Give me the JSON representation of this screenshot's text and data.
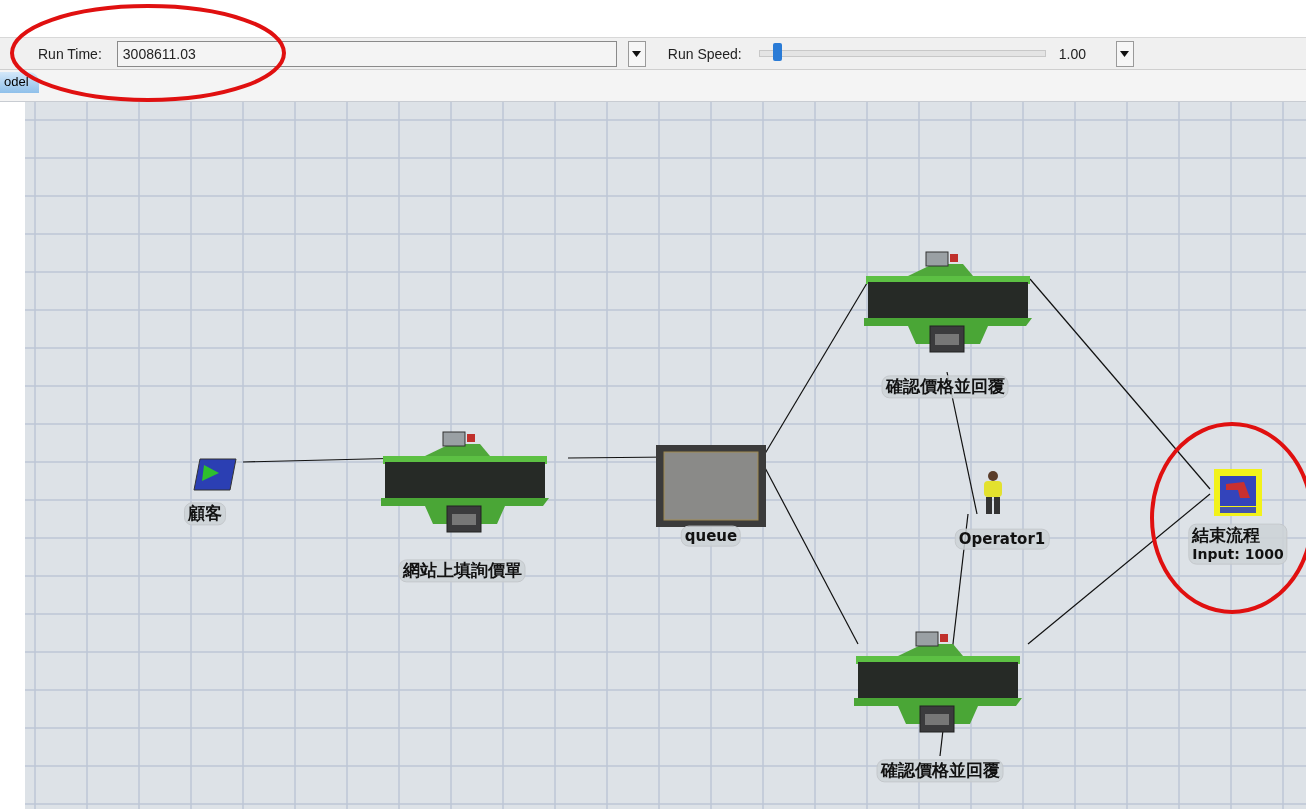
{
  "toolbar": {
    "run_time": {
      "label": "Run Time:",
      "value": "3008611.03"
    },
    "run_speed": {
      "label": "Run Speed:",
      "level": 0.06,
      "reading": "1.00"
    }
  },
  "tabs": [
    {
      "label": "odel",
      "selected": true
    }
  ],
  "model": {
    "nodes": [
      {
        "kind": "source",
        "label": "顧客",
        "selected": false
      },
      {
        "kind": "processor",
        "label": "網站上填詢價單",
        "selected": false
      },
      {
        "kind": "queue",
        "label": "queue",
        "selected": false
      },
      {
        "kind": "processor",
        "label": "確認價格並回覆",
        "selected": false
      },
      {
        "kind": "operator",
        "label": "Operator1",
        "selected": false
      },
      {
        "kind": "processor",
        "label": "確認價格並回覆",
        "selected": false
      },
      {
        "kind": "sink",
        "label": "結束流程",
        "stats": "Input: 1000",
        "selected": true
      }
    ]
  }
}
